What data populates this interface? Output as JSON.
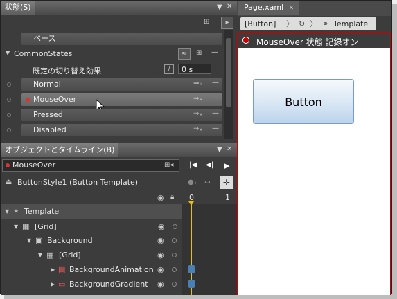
{
  "states_panel": {
    "tab": "状態(S)",
    "base": "ベース",
    "group": "CommonStates",
    "transition_label": "既定の切り替え効果",
    "transition_value": "0 s",
    "states": [
      "Normal",
      "MouseOver",
      "Pressed",
      "Disabled"
    ]
  },
  "objects_panel": {
    "tab": "オブジェクトとタイムライン(B)",
    "storyboard": "MouseOver",
    "template_title": "ButtonStyle1 (Button Template)",
    "ruler": [
      "0",
      "1"
    ],
    "tree": [
      {
        "label": "Template",
        "indent": 0
      },
      {
        "label": "[Grid]",
        "indent": 1
      },
      {
        "label": "Background",
        "indent": 2
      },
      {
        "label": "[Grid]",
        "indent": 3
      },
      {
        "label": "BackgroundAnimation",
        "indent": 4
      },
      {
        "label": "BackgroundGradient",
        "indent": 4
      }
    ]
  },
  "editor": {
    "doc_tab": "Page.xaml",
    "breadcrumb": [
      "[Button]",
      "Template"
    ],
    "recording": "MouseOver 状態 記録オン",
    "button_label": "Button"
  },
  "colors": {
    "record": "#cc0000",
    "timeline_marker": "#f0c000",
    "keyframe": "#4a7fb5"
  }
}
